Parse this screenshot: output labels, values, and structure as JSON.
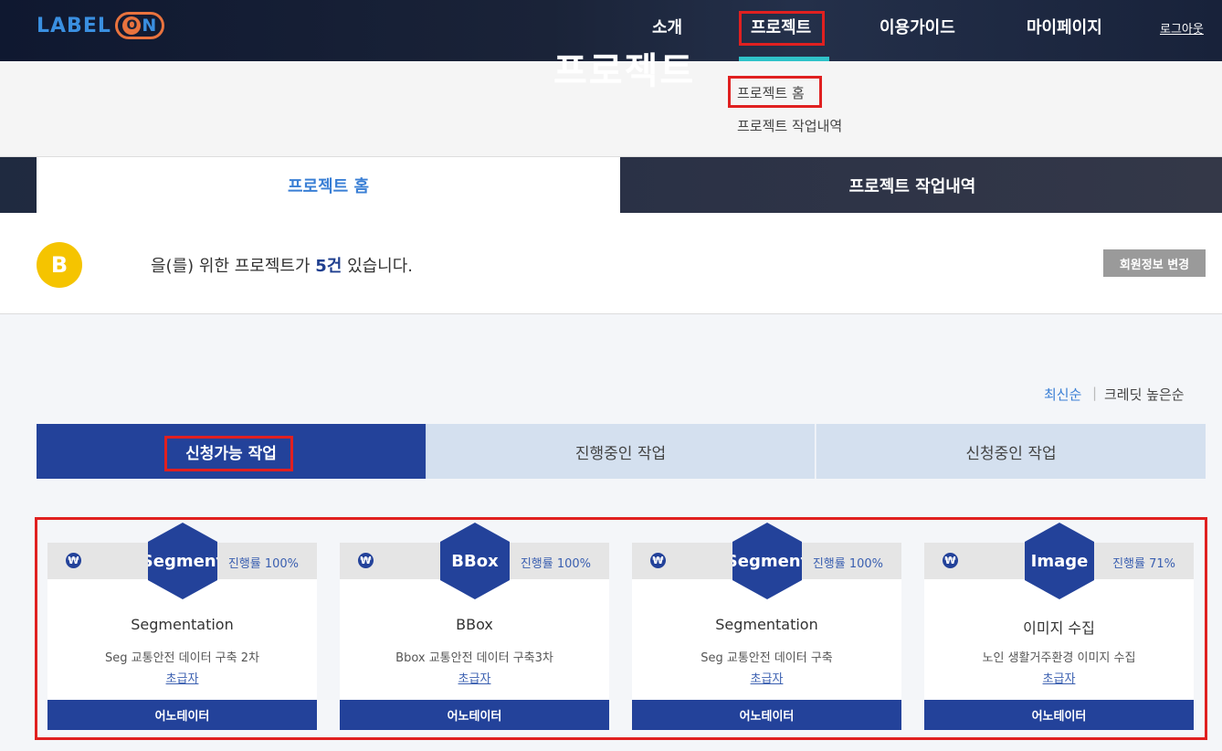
{
  "header": {
    "logo_text": "LABEL",
    "logo_on": "N",
    "logo_o": "O",
    "nav": [
      "소개",
      "프로젝트",
      "이용가이드",
      "마이페이지"
    ],
    "logout": "로그아웃"
  },
  "dropdown": {
    "ghost_title": "프로젝트",
    "items": [
      "프로젝트 홈",
      "프로젝트 작업내역"
    ]
  },
  "subtabs": [
    "프로젝트 홈",
    "프로젝트 작업내역"
  ],
  "info": {
    "avatar_letter": "B",
    "text_before": "을(를) 위한 프로젝트가 ",
    "count": "5건",
    "text_after": " 있습니다.",
    "edit_button": "회원정보 변경"
  },
  "sort": {
    "latest": "최신순",
    "separator": "|",
    "credit": "크레딧 높은순"
  },
  "job_tabs": [
    "신청가능 작업",
    "진행중인 작업",
    "신청중인 작업"
  ],
  "cards": [
    {
      "won": "₩",
      "badge": "Segment",
      "progress": "진행률 100%",
      "title": "Segmentation",
      "desc": "Seg 교통안전 데이터 구축 2차",
      "level": "초급자",
      "button": "어노테이터"
    },
    {
      "won": "₩",
      "badge": "BBox",
      "progress": "진행률 100%",
      "title": "BBox",
      "desc": "Bbox 교통안전 데이터 구축3차",
      "level": "초급자",
      "button": "어노테이터"
    },
    {
      "won": "₩",
      "badge": "Segment",
      "progress": "진행률 100%",
      "title": "Segmentation",
      "desc": "Seg 교통안전 데이터 구축",
      "level": "초급자",
      "button": "어노테이터"
    },
    {
      "won": "₩",
      "badge": "Image",
      "progress": "진행률 71%",
      "title": "이미지 수집",
      "desc": "노인 생활거주환경 이미지 수집",
      "level": "초급자",
      "button": "어노테이터"
    }
  ]
}
